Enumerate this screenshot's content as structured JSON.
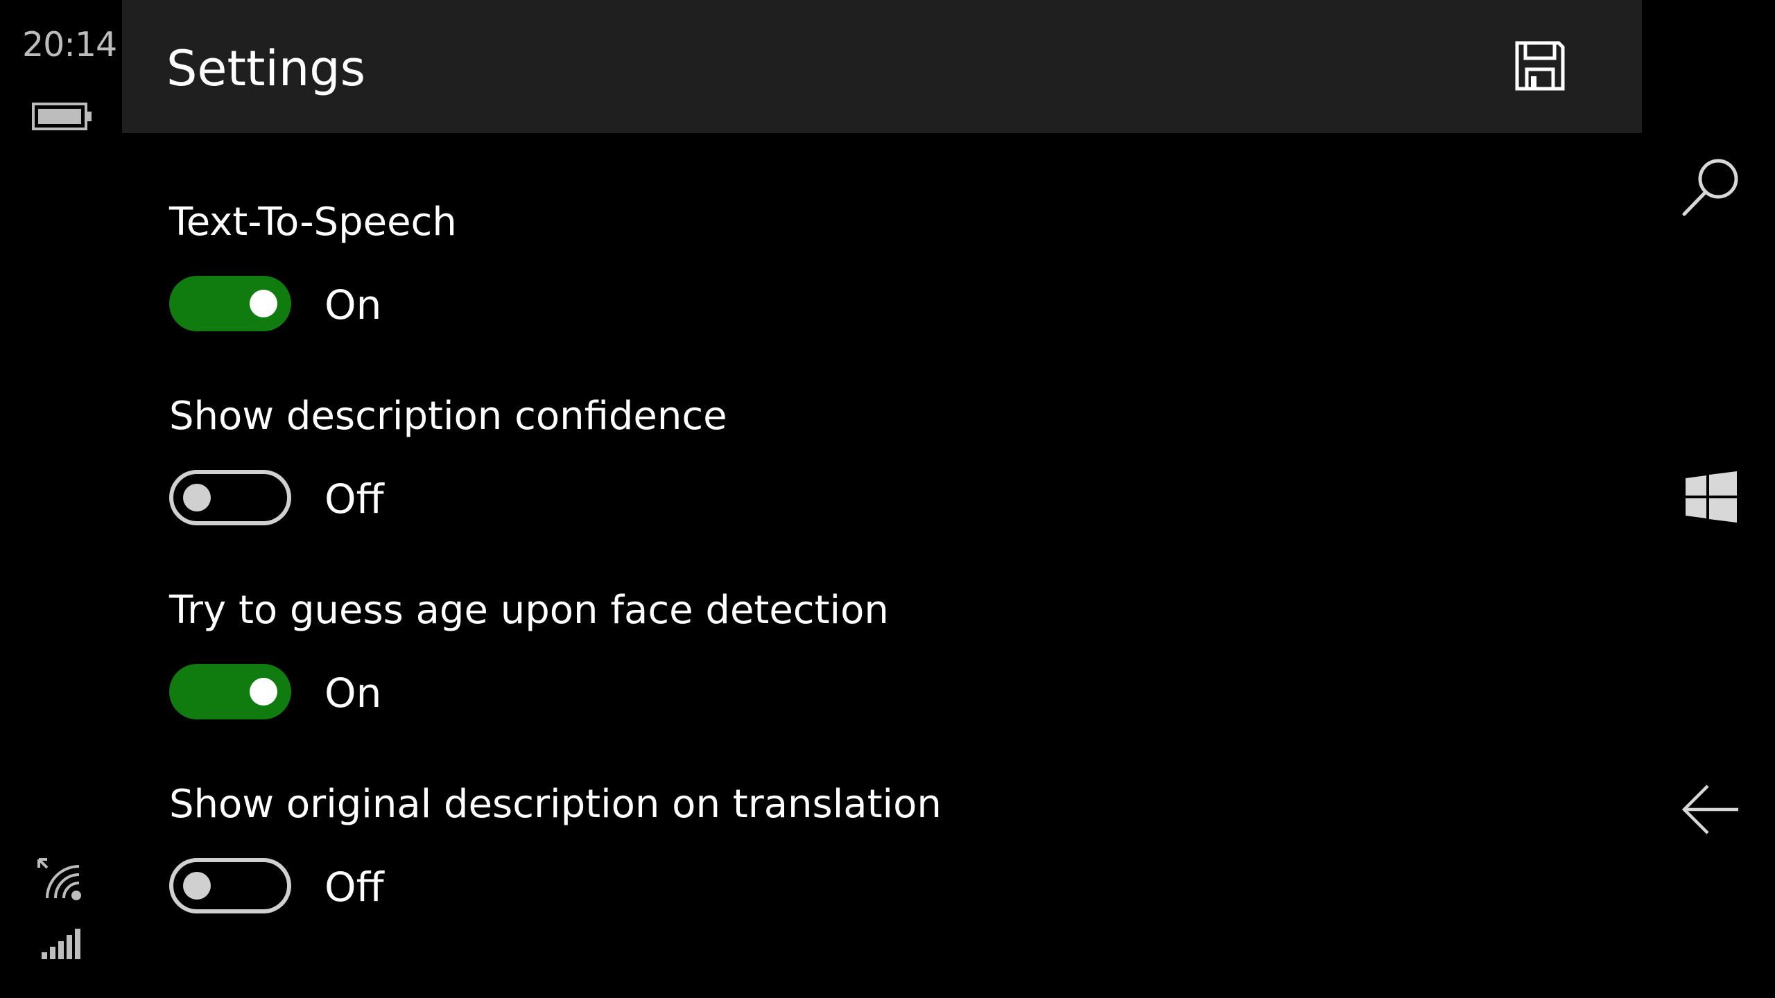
{
  "status": {
    "time": "20:14"
  },
  "header": {
    "title": "Settings"
  },
  "settings": [
    {
      "label": "Text-To-Speech",
      "state": "On",
      "enabled": true
    },
    {
      "label": "Show description confidence",
      "state": "Off",
      "enabled": false
    },
    {
      "label": "Try to guess age upon face detection",
      "state": "On",
      "enabled": true
    },
    {
      "label": "Show original description on translation",
      "state": "Off",
      "enabled": false
    }
  ],
  "colors": {
    "toggle_on": "#107c10",
    "header_bg": "#1f1f1f",
    "background": "#000000"
  },
  "icons": {
    "header": [
      "save-icon"
    ],
    "nav": [
      "search-icon",
      "windows-icon",
      "back-arrow-icon"
    ],
    "status": [
      "battery-icon",
      "wifi-icon",
      "signal-icon"
    ]
  }
}
